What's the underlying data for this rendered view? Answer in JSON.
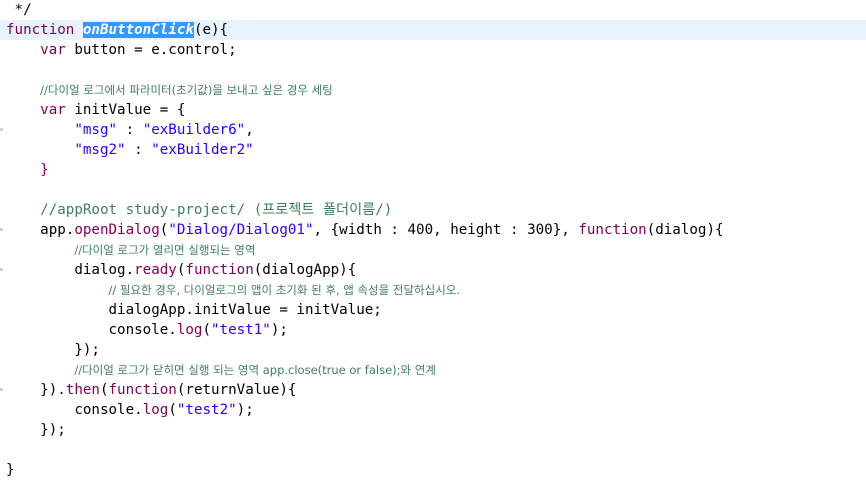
{
  "editor": {
    "lines": [
      " */",
      "function onButtonClick(e){",
      "    var button = e.control;",
      "",
      "    //다이얼 로그에서 파라미터(초기값)을 보내고 싶은 경우 세팅",
      "    var initValue = {",
      "        \"msg\" : \"exBuilder6\",",
      "        \"msg2\" : \"exBuilder2\"",
      "    }",
      "",
      "    //appRoot study-project/ (프로젝트 폴더이름/)",
      "    app.openDialog(\"Dialog/Dialog01\", {width : 400, height : 300}, function(dialog){",
      "        //다이얼 로그가 열리면 실행되는 영역",
      "        dialog.ready(function(dialogApp){",
      "            // 필요한 경우, 다이얼로그의 앱이 초기화 된 후, 앱 속성을 전달하십시오.",
      "            dialogApp.initValue = initValue;",
      "            console.log(\"test1\");",
      "        });",
      "        //다이얼 로그가 닫히면 실행 되는 영역 app.close(true or false);와 연계",
      "    }).then(function(returnValue){",
      "        console.log(\"test2\");",
      "    });",
      "",
      "}"
    ],
    "tokens": {
      "l0": " */",
      "l1_kw": "function",
      "l1_sel": "onButtonClick",
      "l1_rest": "(e){",
      "l2_kw": "var",
      "l2_rest": " button = e.control;",
      "l4_cmt_a": "//다이얼 로그에서 파라미터(초기값)을 보내고 싶은 경우 세팅",
      "l5_kw": "var",
      "l5_rest": " initValue = {",
      "l6_s1": "\"msg\"",
      "l6_mid": " : ",
      "l6_s2": "\"exBuilder6\"",
      "l6_end": ",",
      "l7_s1": "\"msg2\"",
      "l7_mid": " : ",
      "l7_s2": "\"exBuilder2\"",
      "l8": "}",
      "l10_cmt": "//appRoot study-project/ (프로젝트 폴더이름/)",
      "l11_a": "app.",
      "l11_m": "openDialog",
      "l11_b": "(",
      "l11_s": "\"Dialog/Dialog01\"",
      "l11_c": ", {width : ",
      "l11_n1": "400",
      "l11_d": ", height : ",
      "l11_n2": "300",
      "l11_e": "}, ",
      "l11_kw": "function",
      "l11_f": "(dialog){",
      "l12_cmt": "//다이얼 로그가 열리면 실행되는 영역",
      "l13_a": "dialog.",
      "l13_m": "ready",
      "l13_b": "(",
      "l13_kw": "function",
      "l13_c": "(dialogApp){",
      "l14_cmt": "// 필요한 경우, 다이얼로그의 앱이 초기화 된 후, 앱 속성을 전달하십시오.",
      "l15_a": "dialogApp.initValue = initValue;",
      "l16_a": "console.",
      "l16_m": "log",
      "l16_b": "(",
      "l16_s": "\"test1\"",
      "l16_c": ");",
      "l17": "});",
      "l18_cmt": "//다이얼 로그가 닫히면 실행 되는 영역 app.close(true or false);와 연계",
      "l19_a": "}).",
      "l19_m": "then",
      "l19_b": "(",
      "l19_kw": "function",
      "l19_c": "(returnValue){",
      "l20_a": "console.",
      "l20_m": "log",
      "l20_b": "(",
      "l20_s": "\"test2\"",
      "l20_c": ");",
      "l21": "});",
      "l23": "}"
    }
  },
  "colors": {
    "keyword": "#7f0055",
    "string": "#2a00ff",
    "comment": "#3f7f5f",
    "selection": "#3399ff",
    "current_line": "#e8f2fe"
  }
}
